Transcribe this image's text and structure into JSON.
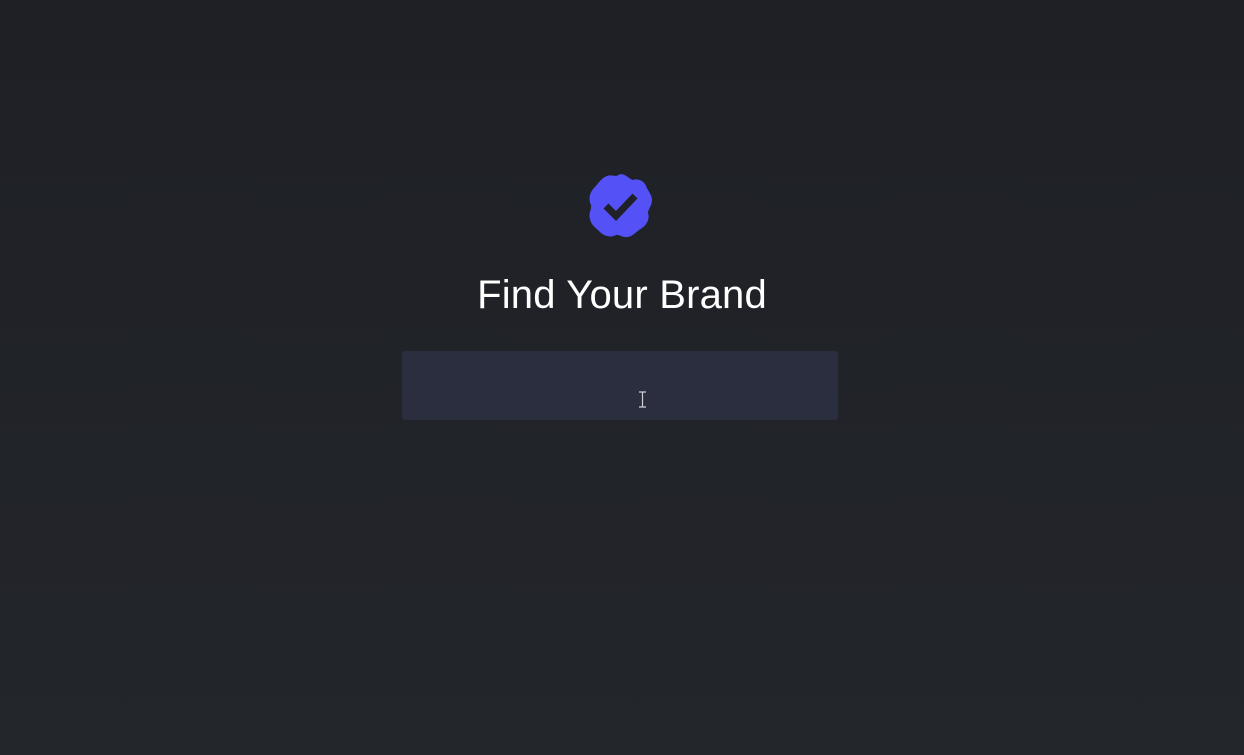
{
  "colors": {
    "background": "#1e2025",
    "accent": "#5451f6",
    "input_background": "#2b2e3f",
    "title_text": "#ffffff"
  },
  "logo": {
    "icon": "verified-badge-icon"
  },
  "header": {
    "title": "Find Your Brand"
  },
  "search": {
    "value": "",
    "placeholder": ""
  },
  "cursor": {
    "icon": "text-cursor-icon"
  }
}
